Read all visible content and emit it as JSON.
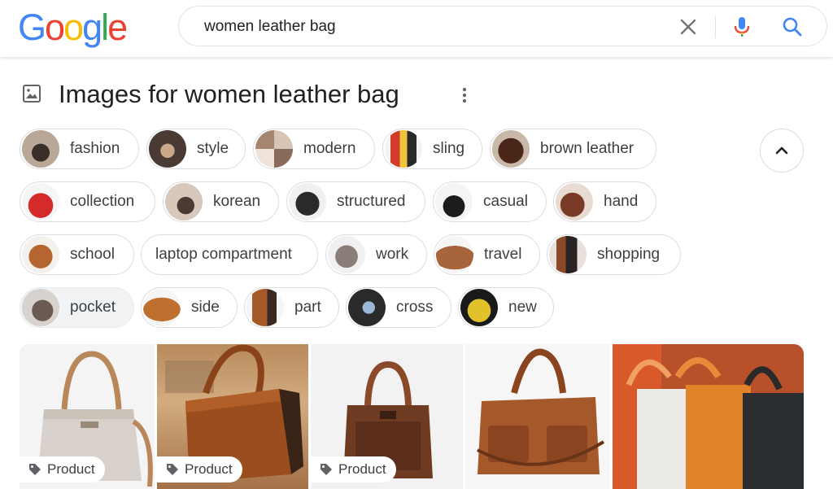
{
  "header": {
    "logo_letters": [
      "G",
      "o",
      "o",
      "g",
      "l",
      "e"
    ],
    "logo_colors": [
      "#4285f4",
      "#ea4335",
      "#fbbc05",
      "#4285f4",
      "#34a853",
      "#ea4335"
    ],
    "search_query": "women leather bag",
    "icons": {
      "clear": "close-icon",
      "voice": "mic-icon",
      "search": "search-icon"
    }
  },
  "section": {
    "icon": "image-icon",
    "title": "Images for women leather bag",
    "more_icon": "more-vert-icon"
  },
  "chips": [
    {
      "label": "fashion",
      "selected": false,
      "thumb_color": "#8a7a6a",
      "has_thumb": true
    },
    {
      "label": "style",
      "selected": false,
      "thumb_color": "#5a4a42",
      "has_thumb": true
    },
    {
      "label": "modern",
      "selected": false,
      "thumb_color": "#c9b8a8",
      "has_thumb": true
    },
    {
      "label": "sling",
      "selected": false,
      "thumb_color": "#d84a3a",
      "has_thumb": true
    },
    {
      "label": "brown leather",
      "selected": false,
      "thumb_color": "#5c3322",
      "has_thumb": true
    },
    {
      "label": "collection",
      "selected": false,
      "thumb_color": "#d42a2a",
      "has_thumb": true
    },
    {
      "label": "korean",
      "selected": false,
      "thumb_color": "#8c7870",
      "has_thumb": true
    },
    {
      "label": "structured",
      "selected": false,
      "thumb_color": "#2a2a2a",
      "has_thumb": true
    },
    {
      "label": "casual",
      "selected": false,
      "thumb_color": "#1e1e1e",
      "has_thumb": true
    },
    {
      "label": "hand",
      "selected": false,
      "thumb_color": "#7a3a28",
      "has_thumb": true
    },
    {
      "label": "school",
      "selected": false,
      "thumb_color": "#b5652e",
      "has_thumb": true
    },
    {
      "label": "laptop compartment",
      "selected": false,
      "has_thumb": false
    },
    {
      "label": "work",
      "selected": false,
      "thumb_color": "#8a7f78",
      "has_thumb": true
    },
    {
      "label": "travel",
      "selected": false,
      "thumb_color": "#a8643a",
      "has_thumb": true
    },
    {
      "label": "shopping",
      "selected": false,
      "thumb_color": "#3a2a22",
      "has_thumb": true
    },
    {
      "label": "pocket",
      "selected": true,
      "thumb_color": "#6a5a52",
      "has_thumb": true
    },
    {
      "label": "side",
      "selected": false,
      "thumb_color": "#c0702e",
      "has_thumb": true
    },
    {
      "label": "part",
      "selected": false,
      "thumb_color": "#a55a2a",
      "has_thumb": true
    },
    {
      "label": "cross",
      "selected": false,
      "thumb_color": "#3a4a5a",
      "has_thumb": true
    },
    {
      "label": "new",
      "selected": false,
      "thumb_color": "#e2c22a",
      "has_thumb": true
    }
  ],
  "collapse_icon": "chevron-up-icon",
  "results": [
    {
      "tag": "Product",
      "bg": "#f4f4f4",
      "bag_color": "#d9d2cc",
      "handle_color": "#b8875a"
    },
    {
      "tag": "Product",
      "bg": "#c49a6c",
      "bag_color": "#9a4e1e",
      "handle_color": "#8a4218"
    },
    {
      "tag": "Product",
      "bg": "#f2f2f2",
      "bag_color": "#6e3a22",
      "handle_color": "#8a4a2a"
    },
    {
      "tag": "",
      "bg": "#f6f6f6",
      "bag_color": "#a5582a",
      "handle_color": "#8a4420"
    },
    {
      "tag": "",
      "bg": "#b8502a",
      "bag_color": "#e2832a",
      "handle_color": "#e88a3a"
    }
  ],
  "tag_icon": "label-icon"
}
